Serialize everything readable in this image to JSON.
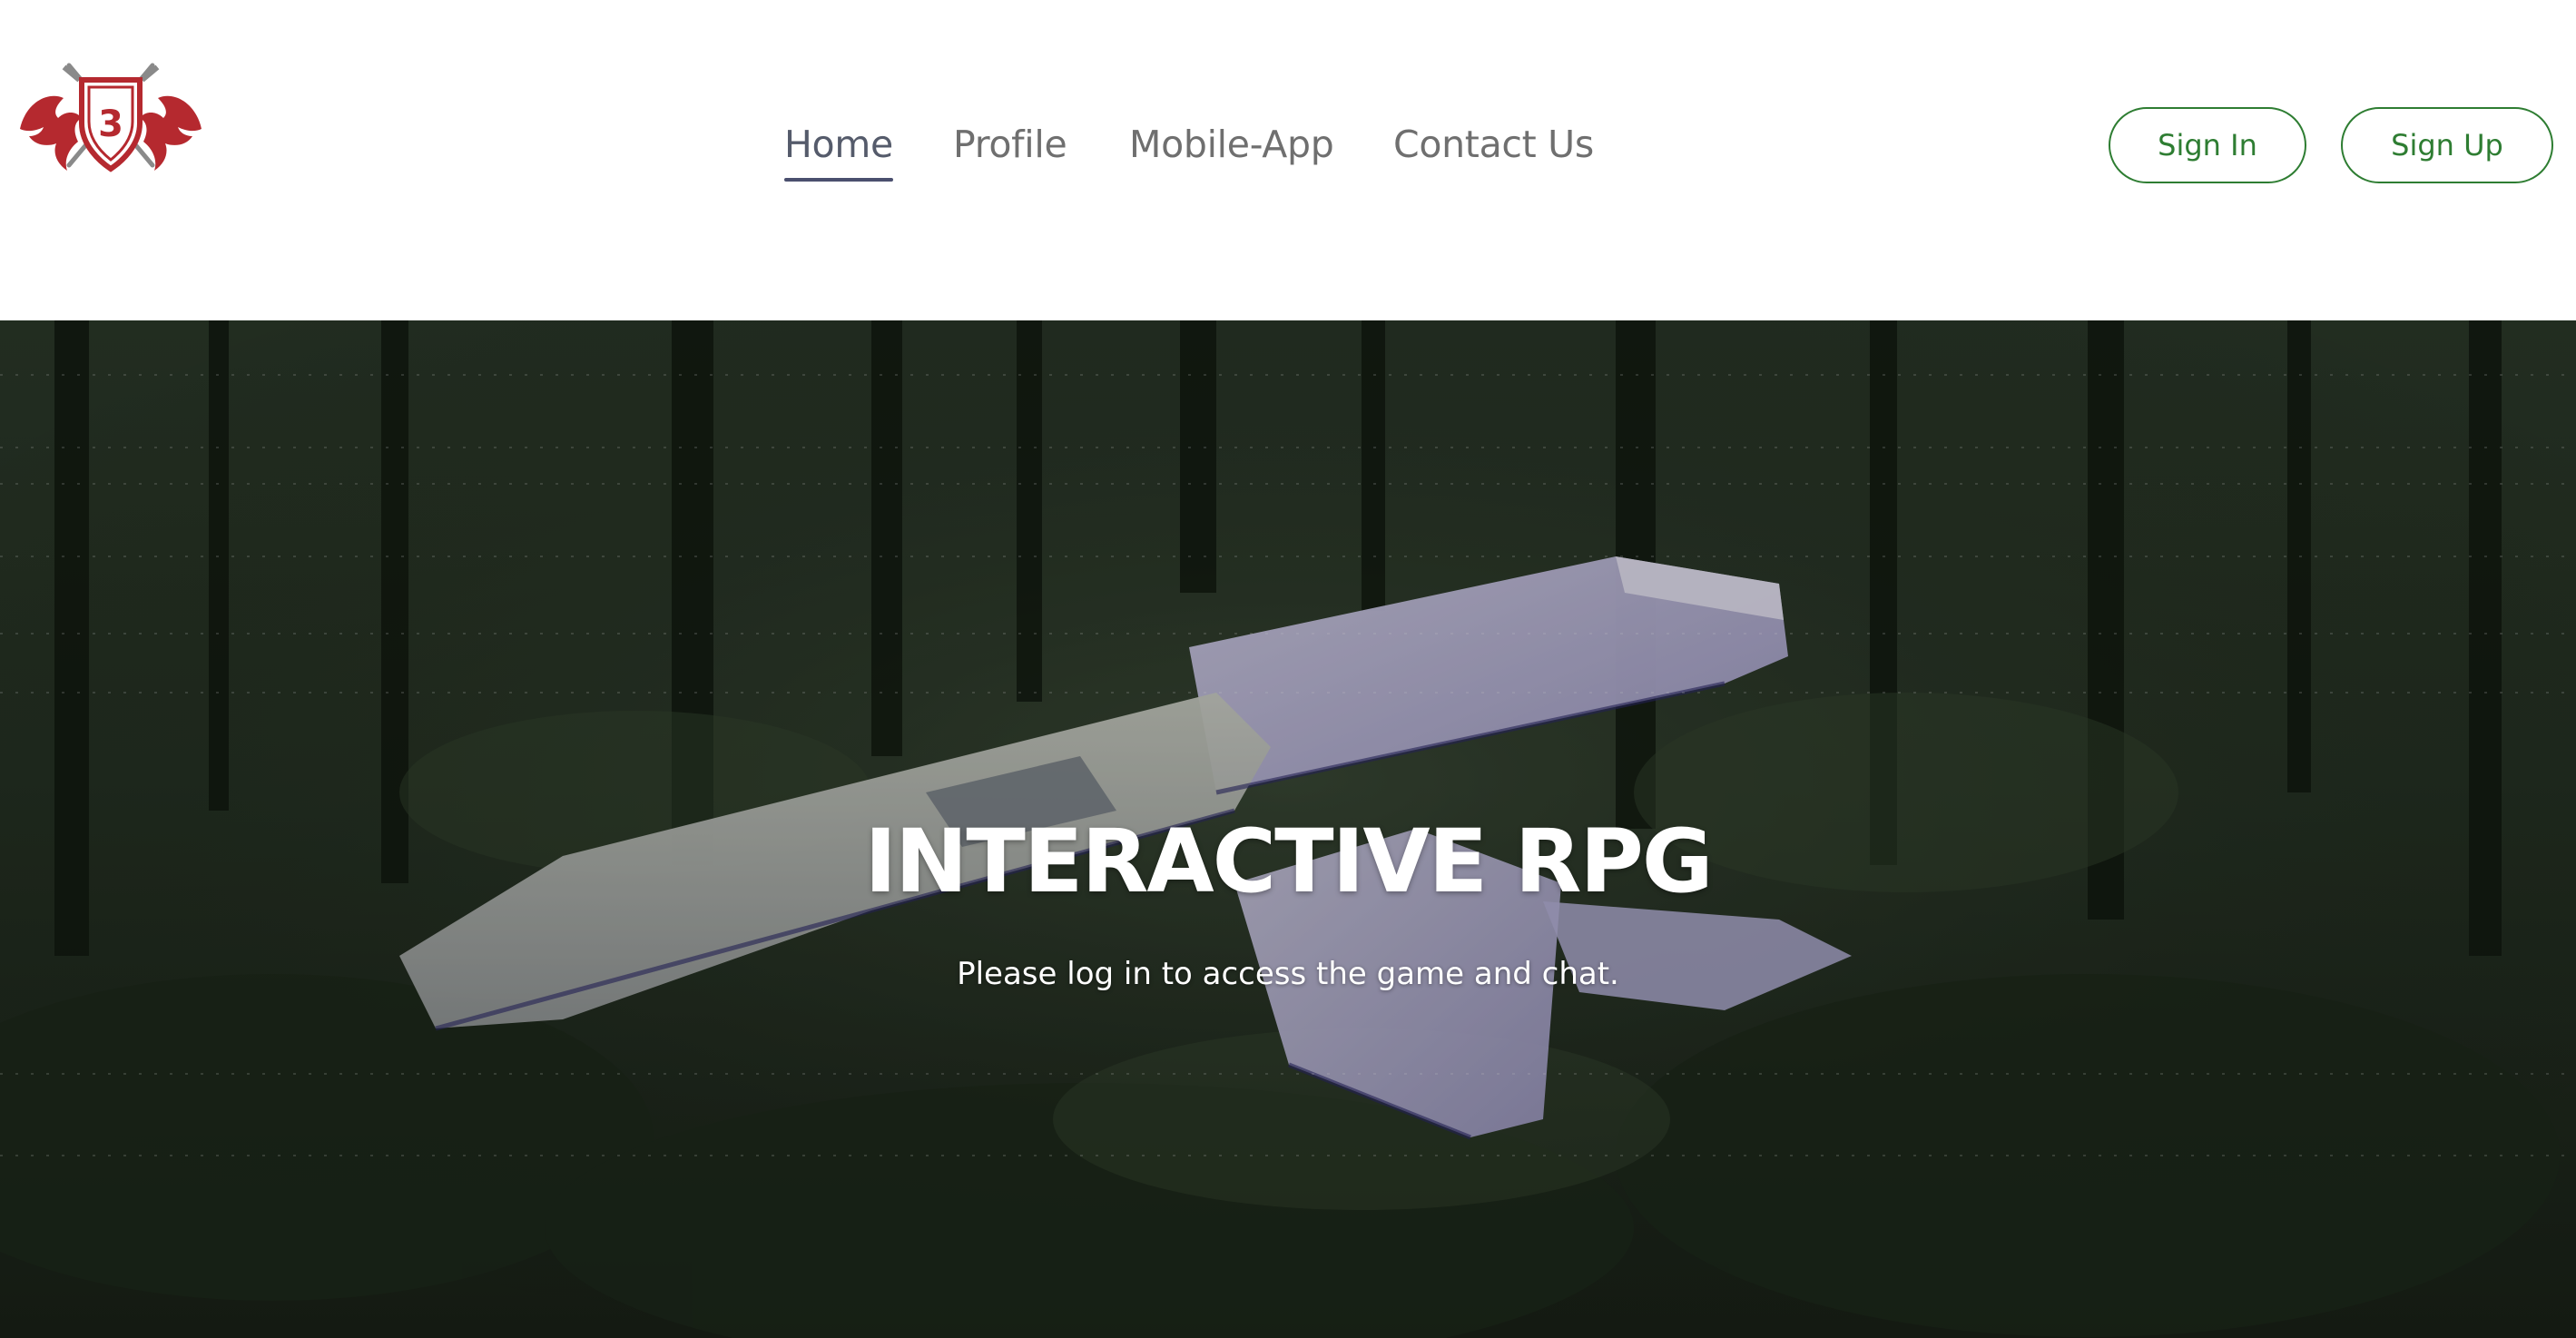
{
  "brand": {
    "logo_icon": "dragon-shield-logo-icon",
    "logo_number": "3",
    "logo_color": "#b5292f"
  },
  "nav": {
    "items": [
      {
        "label": "Home",
        "active": true
      },
      {
        "label": "Profile",
        "active": false
      },
      {
        "label": "Mobile-App",
        "active": false
      },
      {
        "label": "Contact Us",
        "active": false
      }
    ]
  },
  "auth": {
    "sign_in_label": "Sign In",
    "sign_up_label": "Sign Up",
    "accent_color": "#2e7d32"
  },
  "hero": {
    "title": "INTERACTIVE RPG",
    "subtitle": "Please log in to access the game and chat.",
    "background_icon": "crashed-plane-forest-image"
  }
}
